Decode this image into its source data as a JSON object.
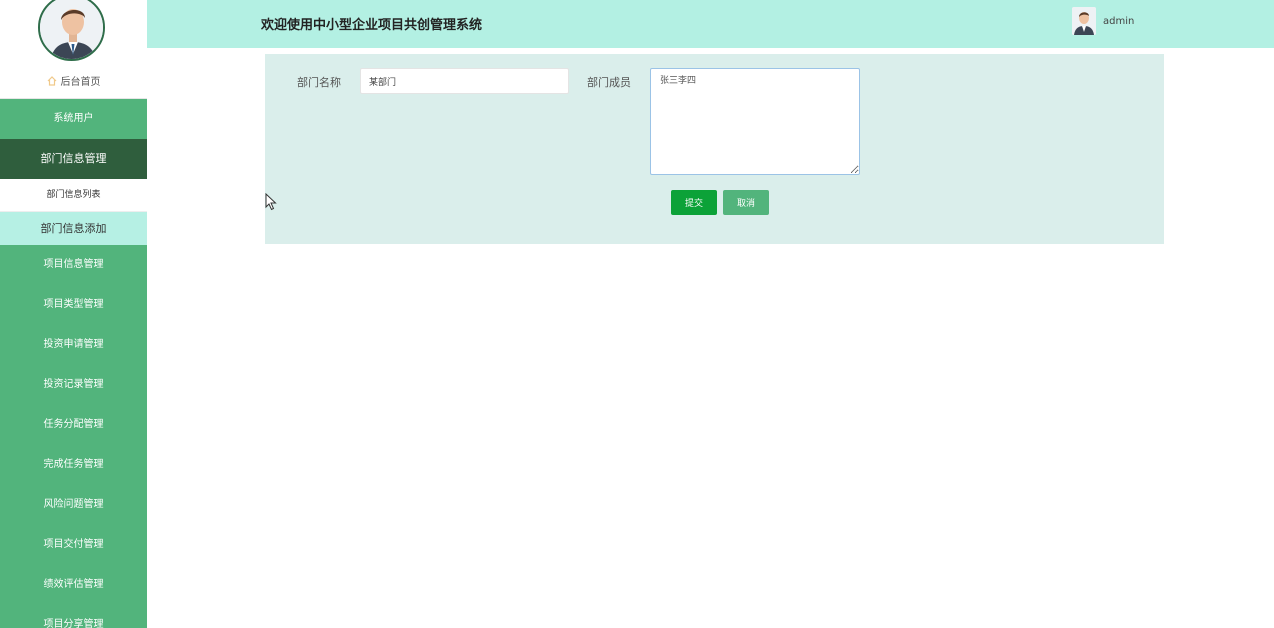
{
  "header": {
    "title": "欢迎使用中小型企业项目共创管理系统",
    "username": "admin"
  },
  "sidebar": {
    "home_label": "后台首页",
    "items": [
      {
        "label": "系统用户"
      },
      {
        "label": "部门信息管理"
      },
      {
        "label": "部门信息列表"
      },
      {
        "label": "部门信息添加"
      },
      {
        "label": "项目信息管理"
      },
      {
        "label": "项目类型管理"
      },
      {
        "label": "投资申请管理"
      },
      {
        "label": "投资记录管理"
      },
      {
        "label": "任务分配管理"
      },
      {
        "label": "完成任务管理"
      },
      {
        "label": "风险问题管理"
      },
      {
        "label": "项目交付管理"
      },
      {
        "label": "绩效评估管理"
      },
      {
        "label": "项目分享管理"
      }
    ]
  },
  "form": {
    "dept_name_label": "部门名称",
    "dept_name_value": "某部门",
    "members_label": "部门成员",
    "members_value": "张三李四",
    "submit_label": "提交",
    "cancel_label": "取消"
  },
  "colors": {
    "sidebar_green": "#52b47c",
    "sidebar_active": "#2f5e3d",
    "header_bg": "#b3f0e3",
    "panel_bg": "#daeeeb",
    "submit_green": "#0ca238"
  }
}
